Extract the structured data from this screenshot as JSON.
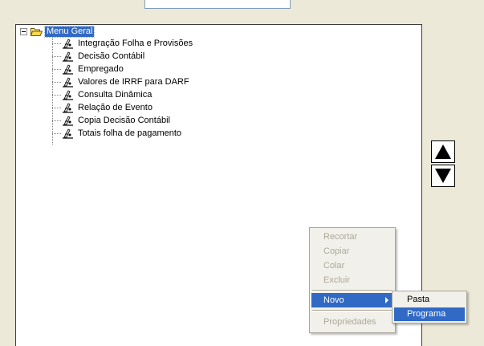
{
  "tree": {
    "root_label": "Menu Geral",
    "items": [
      {
        "label": "Integração Folha e Provisões"
      },
      {
        "label": "Decisão Contábil"
      },
      {
        "label": "Empregado"
      },
      {
        "label": "Valores de IRRF para DARF"
      },
      {
        "label": "Consulta Dinâmica"
      },
      {
        "label": "Relação de Evento"
      },
      {
        "label": "Copia Decisão Contábil"
      },
      {
        "label": "Totais folha de pagamento"
      }
    ]
  },
  "context_menu": {
    "cut": "Recortar",
    "copy": "Copiar",
    "paste": "Colar",
    "delete": "Excluir",
    "new": "Novo",
    "properties": "Propriedades"
  },
  "submenu": {
    "folder": "Pasta",
    "program": "Programa"
  },
  "icons": {
    "expander": "collapse-minus-icon",
    "root": "open-folder-icon",
    "item": "program-document-icon",
    "up": "arrow-up-icon",
    "down": "arrow-down-icon"
  },
  "colors": {
    "selection": "#316ac5",
    "window_bg": "#ece9d8",
    "menu_bg": "#f1f0ea",
    "disabled_text": "#aca899"
  }
}
